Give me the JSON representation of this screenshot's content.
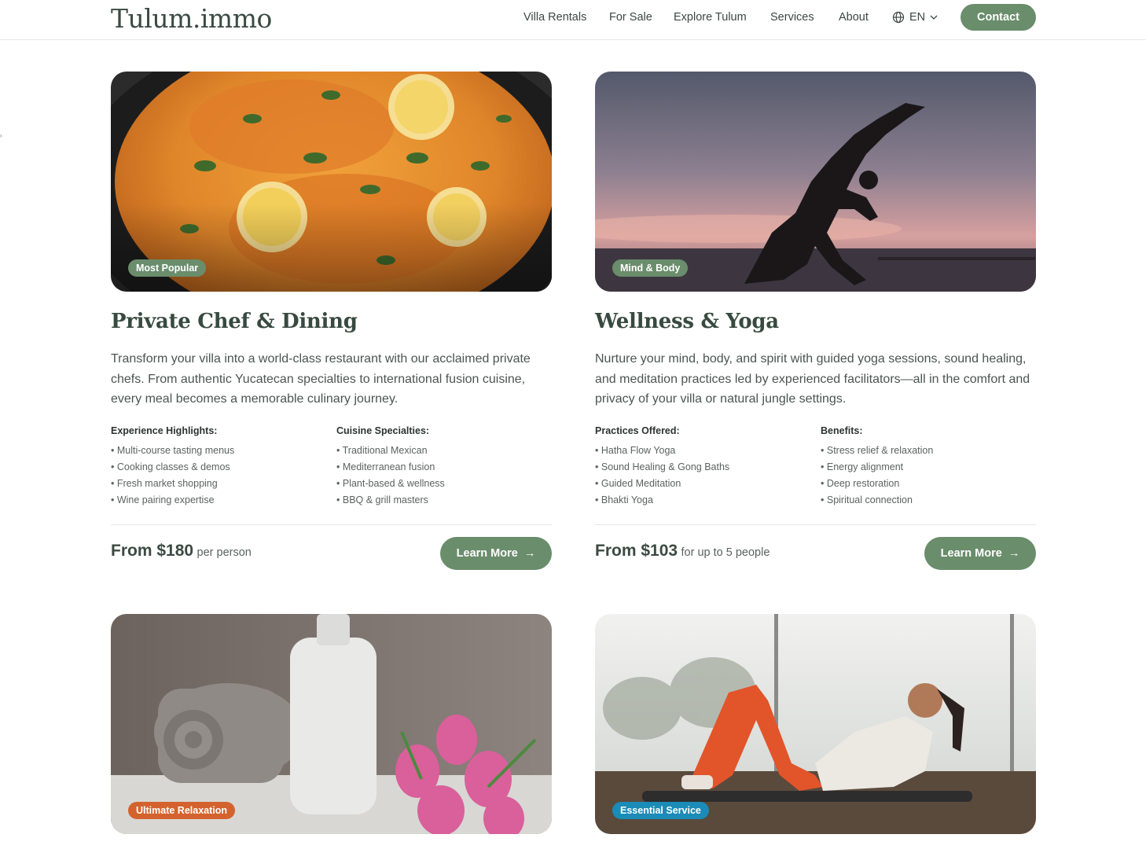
{
  "header": {
    "logo": "Tulum.immo",
    "nav": [
      "Villa Rentals",
      "For Sale",
      "Explore Tulum",
      "Services",
      "About"
    ],
    "language": "EN",
    "contact_label": "Contact"
  },
  "colors": {
    "accent_green": "#6a8d6c",
    "badge_green": "#6a8d6c",
    "badge_orange": "#d4622e",
    "badge_blue": "#1b8bb7",
    "title_dark": "#384a40"
  },
  "cards": [
    {
      "badge": "Most Popular",
      "title": "Private Chef & Dining",
      "description": "Transform your villa into a world-class restaurant with our acclaimed private chefs. From authentic Yucatecan specialties to international fusion cuisine, every meal becomes a memorable culinary journey.",
      "col1_title": "Experience Highlights:",
      "col1_items": [
        "Multi-course tasting menus",
        "Cooking classes & demos",
        "Fresh market shopping",
        "Wine pairing expertise"
      ],
      "col2_title": "Cuisine Specialties:",
      "col2_items": [
        "Traditional Mexican",
        "Mediterranean fusion",
        "Plant-based & wellness",
        "BBQ & grill masters"
      ],
      "price": "From $180",
      "price_unit": "per person",
      "cta": "Learn More"
    },
    {
      "badge": "Mind & Body",
      "title": "Wellness & Yoga",
      "description": "Nurture your mind, body, and spirit with guided yoga sessions, sound healing, and meditation practices led by experienced facilitators—all in the comfort and privacy of your villa or natural jungle settings.",
      "col1_title": "Practices Offered:",
      "col1_items": [
        "Hatha Flow Yoga",
        "Sound Healing & Gong Baths",
        "Guided Meditation",
        "Bhakti Yoga"
      ],
      "col2_title": "Benefits:",
      "col2_items": [
        "Stress relief & relaxation",
        "Energy alignment",
        "Deep restoration",
        "Spiritual connection"
      ],
      "price": "From $103",
      "price_unit": "for up to 5 people",
      "cta": "Learn More"
    },
    {
      "badge": "Ultimate Relaxation"
    },
    {
      "badge": "Essential Service"
    }
  ]
}
